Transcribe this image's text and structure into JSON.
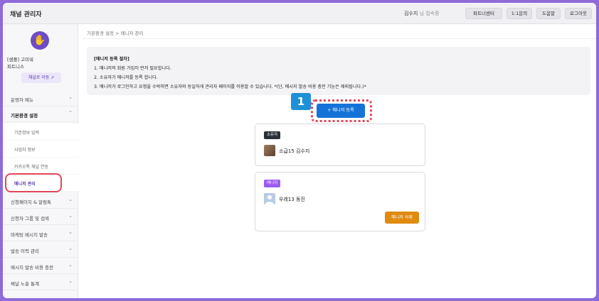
{
  "app": {
    "title": "채널 관리자"
  },
  "header": {
    "user_name": "김수지",
    "user_suffix": "님 접속중",
    "buttons": [
      "파트너센터",
      "1:1문의",
      "도움말",
      "로그아웃"
    ]
  },
  "sidebar": {
    "profile": {
      "avatar_icon": "hand-wave-icon",
      "line1": "[샘플] 고미워",
      "line2": "피트니스",
      "channel_button": "채널로 이동"
    },
    "items": [
      {
        "label": "운영자 메뉴",
        "expanded": false
      },
      {
        "label": "기본환경 설정",
        "expanded": true,
        "children": [
          "기본정보 입력",
          "사업자 정보",
          "카카오톡 채널 연동",
          "매니저 관리"
        ],
        "active_child": "매니저 관리"
      },
      {
        "label": "신청페이지 & 알림톡",
        "expanded": false
      },
      {
        "label": "신청자 그룹 및 검색",
        "expanded": false
      },
      {
        "label": "마케팅 메시지 발송",
        "expanded": false
      },
      {
        "label": "발송 이력 관리",
        "expanded": false
      },
      {
        "label": "메시지 발송 비용 충전",
        "expanded": false
      },
      {
        "label": "채널 노출 통계",
        "expanded": false
      }
    ]
  },
  "main": {
    "breadcrumb": "기본환경 설정 > 매니저 관리",
    "info": {
      "title": "[매니저 등록 절차]",
      "lines": [
        "1. 매니저의 회원 가입이 먼저 필요합니다.",
        "2. 소유자가 매니저를 등록 합니다.",
        "3. 매니저가 로그인하고 요청을 수락하면 소유자와 동일하게 관리자 페이지를 이용할 수 있습니다. *(단, 메시지 발송 비용 충전 기능은 제외됩니다.)*"
      ]
    },
    "step_badge": "1",
    "register_button": "+ 매니저 등록",
    "owner_card": {
      "role": "소유자",
      "role_color": "#2b2f36",
      "name": "소급15 김수지"
    },
    "manager_card": {
      "role": "매니저",
      "role_color": "#9b5cf0",
      "name": "우레13 동진",
      "delete_button": "매니저 삭제"
    }
  }
}
